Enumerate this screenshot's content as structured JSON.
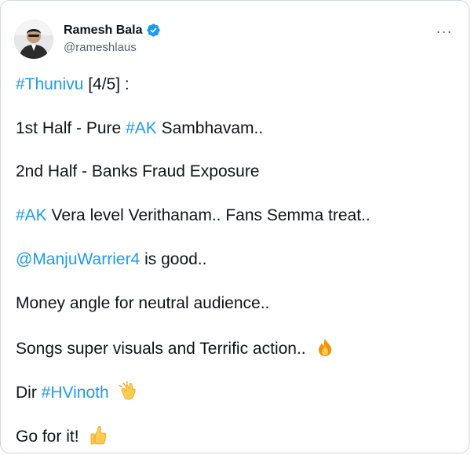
{
  "author": {
    "name": "Ramesh Bala",
    "handle": "@rameshlaus"
  },
  "icons": {
    "verified": "verified-badge-icon",
    "more": "more-options-icon",
    "fire": "fire-emoji",
    "clap": "clapping-hands-emoji",
    "thumbs": "thumbs-up-emoji"
  },
  "more_label": "···",
  "tweet": {
    "l1_tag": "#Thunivu",
    "l1_rest": " [4/5] :",
    "l2_pre": "1st Half - Pure ",
    "l2_tag": "#AK",
    "l2_post": " Sambhavam..",
    "l3": "2nd Half - Banks Fraud Exposure",
    "l4_tag": "#AK",
    "l4_rest": " Vera level Verithanam.. Fans Semma treat..",
    "l5_mention": "@ManjuWarrier4",
    "l5_rest": " is good..",
    "l6": "Money angle for neutral audience..",
    "l7": "Songs super visuals and Terrific action..",
    "l8_pre": "Dir ",
    "l8_tag": "#HVinoth",
    "l9": "Go for it!"
  },
  "colors": {
    "link": "#1d9bf0",
    "text": "#0f1419",
    "muted": "#536471"
  }
}
